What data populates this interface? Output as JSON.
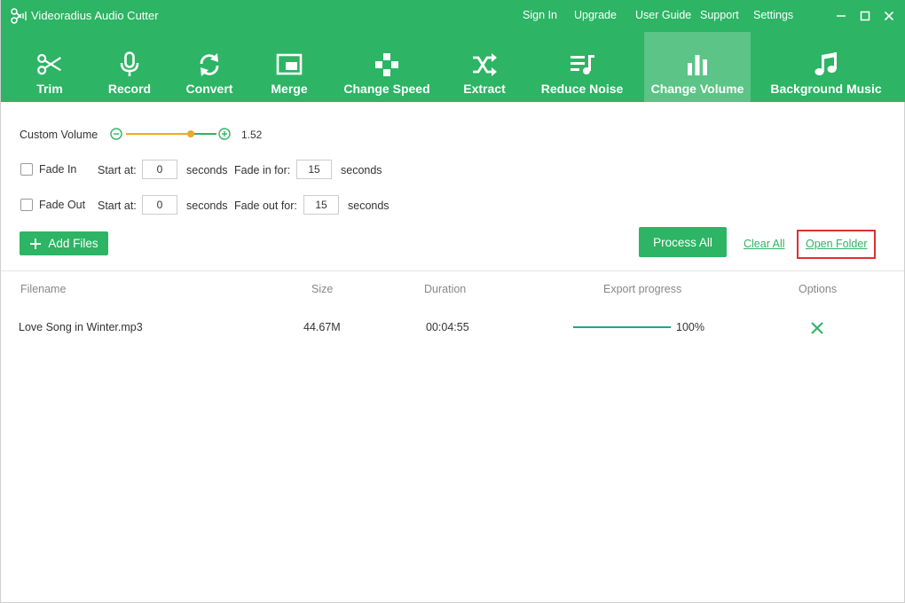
{
  "window": {
    "title": "Videoradius Audio Cutter",
    "top_links": [
      "Sign In",
      "Upgrade",
      "User Guide",
      "Support",
      "Settings"
    ]
  },
  "toolbar": {
    "tools": [
      {
        "label": "Trim",
        "icon": "scissors-icon"
      },
      {
        "label": "Record",
        "icon": "microphone-icon"
      },
      {
        "label": "Convert",
        "icon": "convert-arrows-icon"
      },
      {
        "label": "Merge",
        "icon": "merge-icon"
      },
      {
        "label": "Change Speed",
        "icon": "gamepad-icon"
      },
      {
        "label": "Extract",
        "icon": "shuffle-icon"
      },
      {
        "label": "Reduce Noise",
        "icon": "noise-list-icon"
      },
      {
        "label": "Change Volume",
        "icon": "bars-chart-icon"
      },
      {
        "label": "Background Music",
        "icon": "music-note-icon"
      }
    ],
    "active": "Change Volume"
  },
  "volume": {
    "label": "Custom Volume",
    "value": "1.52",
    "slider_fraction": 0.72
  },
  "fade_in": {
    "label": "Fade In",
    "checked": false,
    "start_label": "Start at:",
    "start_value": "0",
    "seconds_label": "seconds",
    "duration_label": "Fade in for:",
    "duration_value": "15"
  },
  "fade_out": {
    "label": "Fade Out",
    "checked": false,
    "start_label": "Start at:",
    "start_value": "0",
    "seconds_label": "seconds",
    "duration_label": "Fade out for:",
    "duration_value": "15"
  },
  "actions": {
    "add_files": "Add Files",
    "process_all": "Process All",
    "clear_all": "Clear All",
    "open_folder": "Open Folder"
  },
  "table": {
    "headers": [
      "Filename",
      "Size",
      "Duration",
      "Export progress",
      "Options"
    ],
    "rows": [
      {
        "filename": "Love Song in Winter.mp3",
        "size": "44.67M",
        "duration": "00:04:55",
        "progress": "100%",
        "progress_fraction": 1.0
      }
    ]
  },
  "colors": {
    "brand": "#2db464",
    "slider_accent": "#f5a623",
    "progress": "#1aa88e",
    "highlight": "#e03030"
  }
}
